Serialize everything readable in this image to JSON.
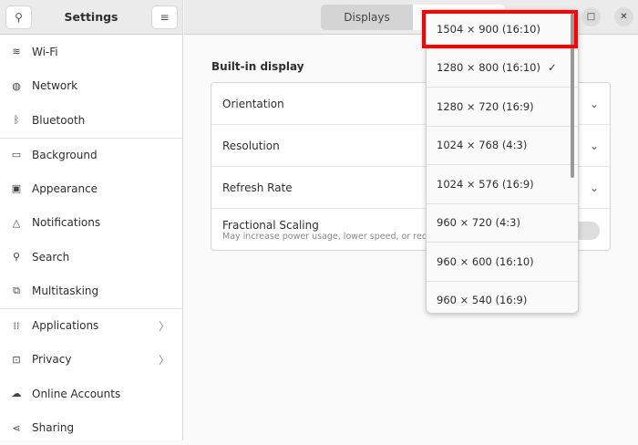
{
  "sidebar": {
    "title": "Settings",
    "items": [
      {
        "label": "Wi-Fi",
        "icon": "wifi-icon"
      },
      {
        "label": "Network",
        "icon": "globe-icon"
      },
      {
        "label": "Bluetooth",
        "icon": "bluetooth-icon"
      },
      {
        "label": "Background",
        "icon": "background-icon"
      },
      {
        "label": "Appearance",
        "icon": "appearance-icon"
      },
      {
        "label": "Notifications",
        "icon": "bell-icon"
      },
      {
        "label": "Search",
        "icon": "search-icon"
      },
      {
        "label": "Multitasking",
        "icon": "multitasking-icon"
      },
      {
        "label": "Applications",
        "icon": "grid-icon"
      },
      {
        "label": "Privacy",
        "icon": "lock-icon"
      },
      {
        "label": "Online Accounts",
        "icon": "cloud-icon"
      },
      {
        "label": "Sharing",
        "icon": "share-icon"
      }
    ]
  },
  "header": {
    "tabs": [
      "Displays"
    ]
  },
  "main": {
    "section": "Built-in display",
    "rows": [
      "Orientation",
      "Resolution",
      "Refresh Rate",
      "Fractional Scaling"
    ],
    "fractional_sub": "May increase power usage, lower speed, or reduc"
  },
  "popup": {
    "options": [
      "1504 × 900 (16:10)",
      "1280 × 800 (16:10)",
      "1280 × 720 (16:9)",
      "1024 × 768 (4:3)",
      "1024 × 576 (16:9)",
      "960 × 720 (4:3)",
      "960 × 600 (16:10)",
      "960 × 540 (16:9)"
    ],
    "selected": "1280 × 800 (16:10)",
    "highlight_color": "#ff0000"
  }
}
